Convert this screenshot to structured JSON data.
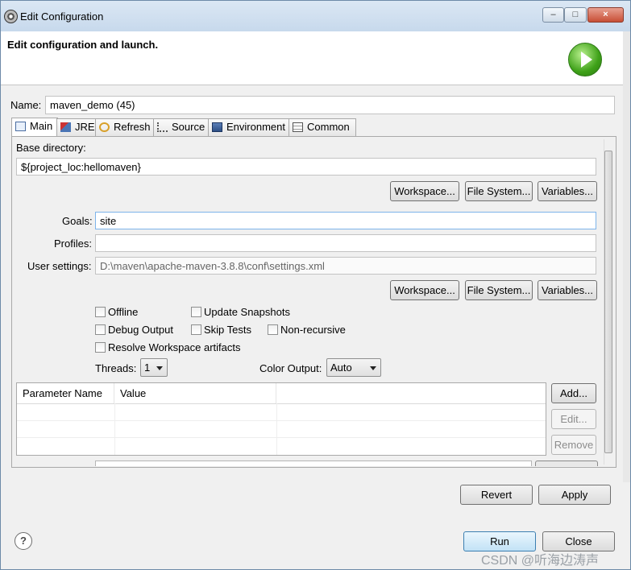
{
  "window": {
    "title": "Edit Configuration",
    "controls": [
      "–",
      "□",
      "×"
    ]
  },
  "header": {
    "title": "Edit configuration and launch."
  },
  "name": {
    "label": "Name:",
    "value": "maven_demo (45)"
  },
  "tabs": [
    {
      "label": "Main",
      "icon": "main-tab-icon",
      "active": true
    },
    {
      "label": "JRE",
      "icon": "jre-icon"
    },
    {
      "label": "Refresh",
      "icon": "refresh-icon"
    },
    {
      "label": "Source",
      "icon": "source-icon"
    },
    {
      "label": "Environment",
      "icon": "environment-icon"
    },
    {
      "label": "Common",
      "icon": "common-icon"
    }
  ],
  "main": {
    "base_directory_label": "Base directory:",
    "base_directory_value": "${project_loc:hellomaven}",
    "workspace_btn": "Workspace...",
    "filesystem_btn": "File System...",
    "variables_btn": "Variables...",
    "goals_label": "Goals:",
    "goals_value": "site",
    "profiles_label": "Profiles:",
    "profiles_value": "",
    "user_settings_label": "User settings:",
    "user_settings_value": "D:\\maven\\apache-maven-3.8.8\\conf\\settings.xml",
    "checkboxes": {
      "offline": "Offline",
      "update_snapshots": "Update Snapshots",
      "debug_output": "Debug Output",
      "skip_tests": "Skip Tests",
      "non_recursive": "Non-recursive",
      "resolve_workspace": "Resolve Workspace artifacts"
    },
    "threads_label": "Threads:",
    "threads_value": "1",
    "color_output_label": "Color Output:",
    "color_output_value": "Auto",
    "table": {
      "columns": [
        "Parameter Name",
        "Value"
      ],
      "rows": []
    },
    "add_btn": "Add...",
    "edit_btn": "Edit...",
    "remove_btn": "Remove"
  },
  "footer": {
    "revert_btn": "Revert",
    "apply_btn": "Apply",
    "run_btn": "Run",
    "close_btn": "Close",
    "help": "?"
  },
  "watermark": "CSDN @听海边涛声",
  "colors": {
    "accent": "#3c7fb1",
    "run_green": "#3ea118"
  }
}
